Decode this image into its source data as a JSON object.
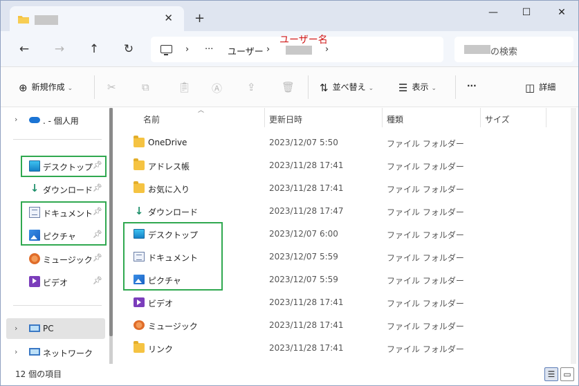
{
  "titlebar": {
    "tab_close": "✕",
    "new_tab": "+",
    "minimize": "—",
    "maximize": "☐",
    "close": "✕"
  },
  "nav": {
    "back": "←",
    "forward": "→",
    "up": "↑",
    "refresh": "↻"
  },
  "address": {
    "sep1": "›",
    "ellipsis": "···",
    "users": "ユーザー",
    "sep2": "›",
    "sep3": "›"
  },
  "annotation": "ユーザー名",
  "search": {
    "suffix": "の検索"
  },
  "commandbar": {
    "new_label": "新規作成",
    "sort_label": "並べ替え",
    "view_label": "表示",
    "more_label": "···",
    "details_label": "詳細"
  },
  "navpane": {
    "onedrive": ". - 個人用",
    "desktop": "デスクトップ",
    "downloads": "ダウンロード",
    "documents": "ドキュメント",
    "pictures": "ピクチャ",
    "music": "ミュージック",
    "videos": "ビデオ",
    "pc": "PC",
    "network": "ネットワーク"
  },
  "columns": {
    "name": "名前",
    "date": "更新日時",
    "type": "種類",
    "size": "サイズ"
  },
  "files": [
    {
      "name": "OneDrive",
      "date": "2023/12/07 5:50",
      "type": "ファイル フォルダー",
      "icon": "folder-icon"
    },
    {
      "name": "アドレス帳",
      "date": "2023/11/28 17:41",
      "type": "ファイル フォルダー",
      "icon": "folder-icon"
    },
    {
      "name": "お気に入り",
      "date": "2023/11/28 17:41",
      "type": "ファイル フォルダー",
      "icon": "folder-icon"
    },
    {
      "name": "ダウンロード",
      "date": "2023/11/28 17:47",
      "type": "ファイル フォルダー",
      "icon": "download-icon"
    },
    {
      "name": "デスクトップ",
      "date": "2023/12/07 6:00",
      "type": "ファイル フォルダー",
      "icon": "desktop-icon"
    },
    {
      "name": "ドキュメント",
      "date": "2023/12/07 5:59",
      "type": "ファイル フォルダー",
      "icon": "documents-icon"
    },
    {
      "name": "ピクチャ",
      "date": "2023/12/07 5:59",
      "type": "ファイル フォルダー",
      "icon": "pictures-icon"
    },
    {
      "name": "ビデオ",
      "date": "2023/11/28 17:41",
      "type": "ファイル フォルダー",
      "icon": "videos-icon"
    },
    {
      "name": "ミュージック",
      "date": "2023/11/28 17:41",
      "type": "ファイル フォルダー",
      "icon": "music-icon"
    },
    {
      "name": "リンク",
      "date": "2023/11/28 17:41",
      "type": "ファイル フォルダー",
      "icon": "folder-icon"
    }
  ],
  "status": {
    "count": "12 個の項目"
  },
  "colors": {
    "highlight_box": "#2fa84f",
    "annotation_text": "#d01818"
  }
}
